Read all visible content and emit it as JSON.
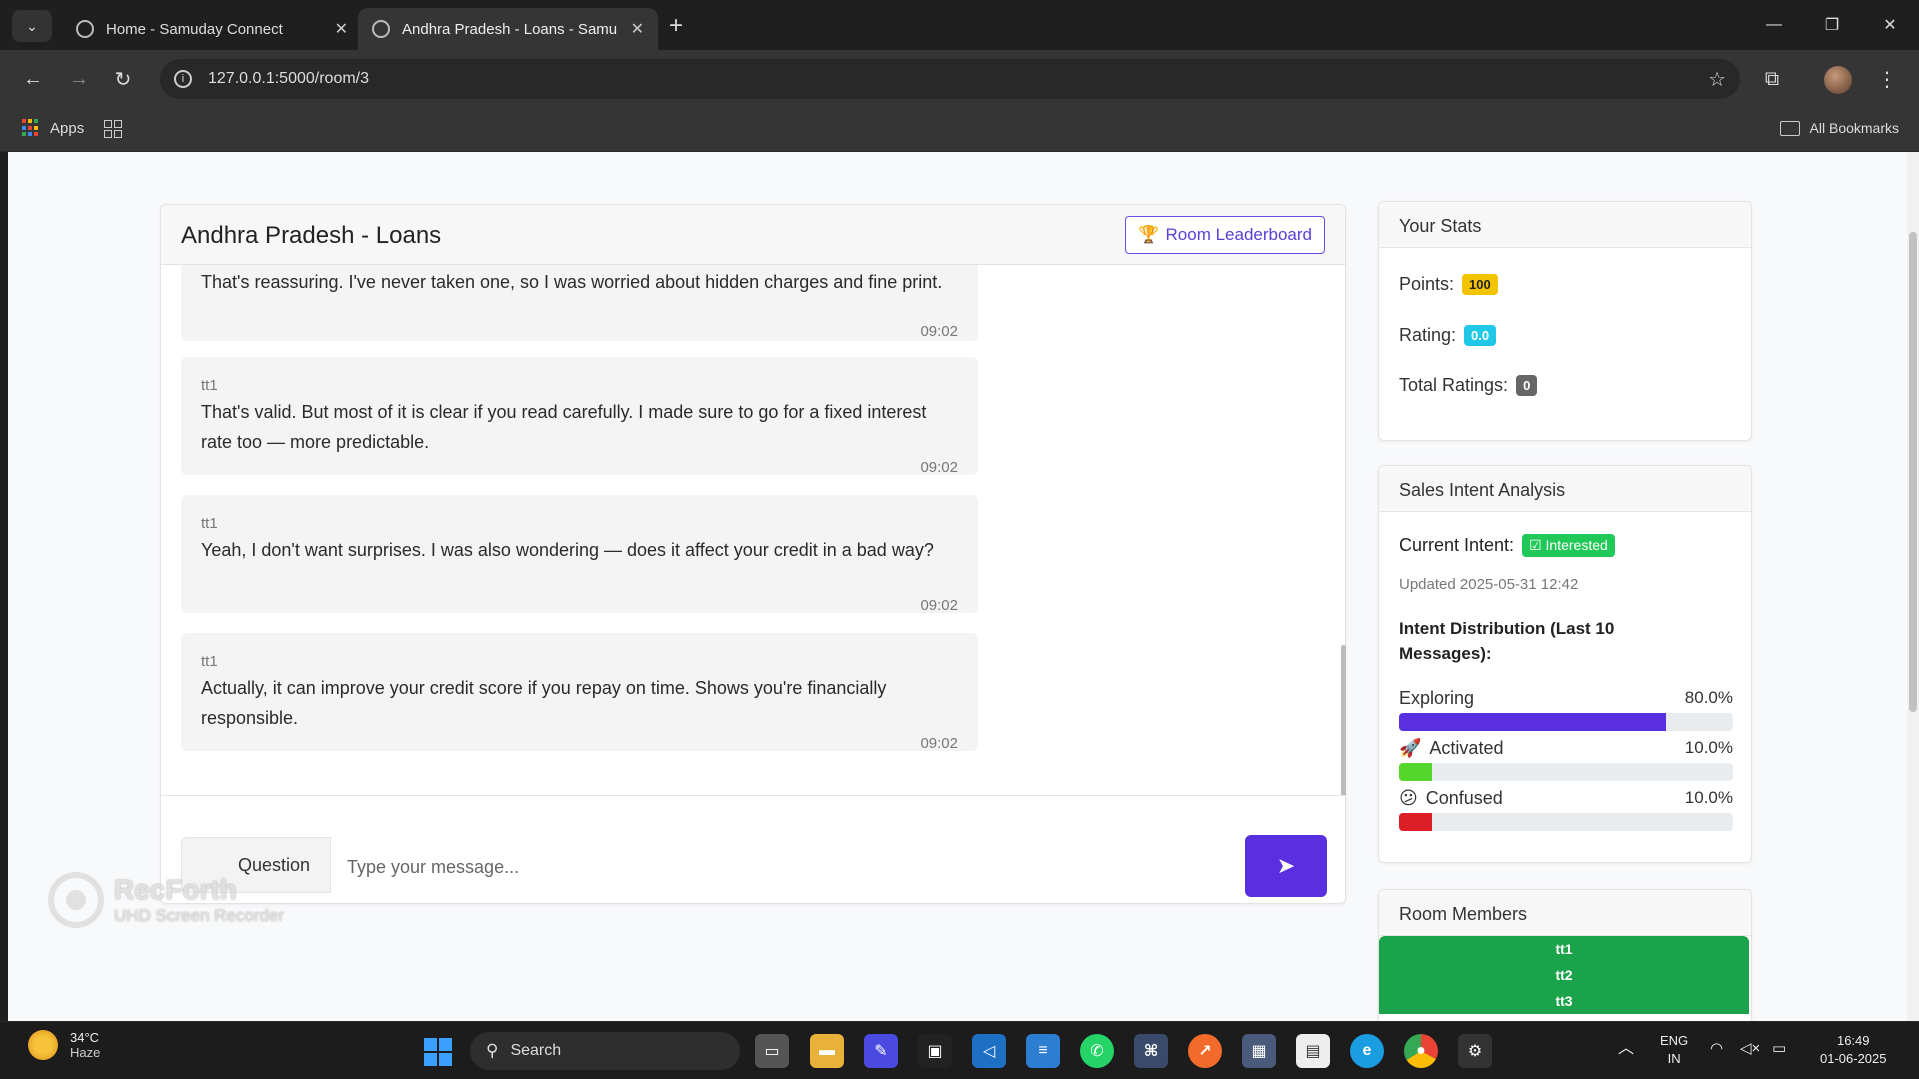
{
  "browser": {
    "tabs": [
      {
        "title": "Home - Samuday Connect",
        "active": false
      },
      {
        "title": "Andhra Pradesh - Loans - Samu",
        "active": true
      }
    ],
    "url": "127.0.0.1:5000/room/3",
    "bookmarks": {
      "apps_label": "Apps",
      "all_bookmarks_label": "All Bookmarks"
    }
  },
  "chat": {
    "title": "Andhra Pradesh - Loans",
    "leaderboard_label": "Room Leaderboard",
    "messages": [
      {
        "sender": "",
        "text": "That's reassuring. I've never taken one, so I was worried about hidden charges and fine print.",
        "time": "09:02"
      },
      {
        "sender": "tt1",
        "text": "That's valid. But most of it is clear if you read carefully. I made sure to go for a fixed interest rate too — more predictable.",
        "time": "09:02"
      },
      {
        "sender": "tt1",
        "text": "Yeah, I don't want surprises. I was also wondering — does it affect your credit in a bad way?",
        "time": "09:02"
      },
      {
        "sender": "tt1",
        "text": "Actually, it can improve your credit score if you repay on time. Shows you're financially responsible.",
        "time": "09:02"
      }
    ],
    "input": {
      "tag": "Question",
      "placeholder": "Type your message..."
    }
  },
  "stats": {
    "title": "Your Stats",
    "points_label": "Points:",
    "points": "100",
    "rating_label": "Rating:",
    "rating": "0.0",
    "total_ratings_label": "Total Ratings:",
    "total_ratings": "0"
  },
  "intent": {
    "title": "Sales Intent Analysis",
    "current_label": "Current Intent:",
    "current_value": "Interested",
    "updated": "Updated 2025-05-31 12:42",
    "distribution_title": "Intent Distribution (Last 10 Messages):",
    "distribution": [
      {
        "label": "Exploring",
        "pct_text": "80.0%",
        "pct": 80,
        "color": "#5a2fe0",
        "icon": ""
      },
      {
        "label": "Activated",
        "pct_text": "10.0%",
        "pct": 10,
        "color": "#55d62b",
        "icon": "rocket-icon"
      },
      {
        "label": "Confused",
        "pct_text": "10.0%",
        "pct": 10,
        "color": "#dc1f26",
        "icon": "confused-face-icon"
      }
    ]
  },
  "members": {
    "title": "Room Members",
    "list": [
      "tt1",
      "tt2",
      "tt3"
    ]
  },
  "watermark": {
    "line1": "RecForth",
    "line2": "UHD Screen Recorder"
  },
  "taskbar": {
    "weather_temp": "34°C",
    "weather_desc": "Haze",
    "search_label": "Search",
    "lang1": "ENG",
    "lang2": "IN",
    "time": "16:49",
    "date": "01-06-2025"
  }
}
